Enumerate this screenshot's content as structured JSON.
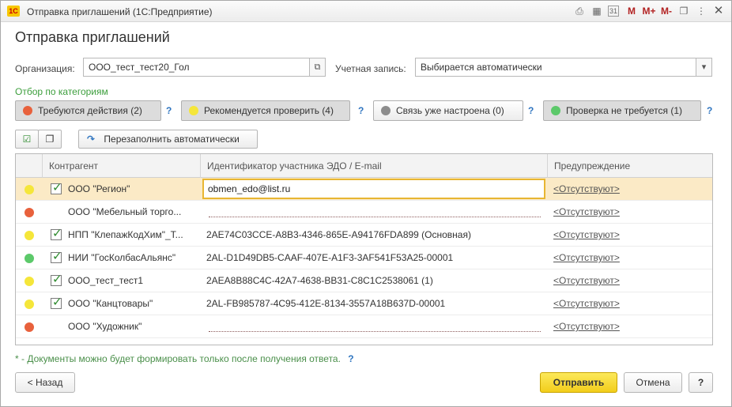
{
  "window": {
    "app_logo": "1С",
    "title": "Отправка приглашений  (1С:Предприятие)",
    "tb_m": "M",
    "tb_mplus": "M+",
    "tb_mminus": "M-",
    "tb_calendar_day": "31"
  },
  "form": {
    "title": "Отправка приглашений"
  },
  "organization": {
    "label": "Организация:",
    "value": "ООО_тест_тест20_Гол"
  },
  "account": {
    "label": "Учетная запись:",
    "value": "Выбирается автоматически"
  },
  "filter": {
    "caption": "Отбор по категориям",
    "buttons": [
      {
        "label": "Требуются действия (2)",
        "color": "#e8613c",
        "pressed": true
      },
      {
        "label": "Рекомендуется проверить (4)",
        "color": "#f5e63a",
        "pressed": true
      },
      {
        "label": "Связь уже настроена (0)",
        "color": "#8c8c8c",
        "pressed": false
      },
      {
        "label": "Проверка не требуется (1)",
        "color": "#5cc96a",
        "pressed": true
      }
    ],
    "help": "?"
  },
  "toolbar": {
    "refill_label": "Перезаполнить автоматически"
  },
  "table": {
    "headers": {
      "counterparty": "Контрагент",
      "identifier": "Идентификатор участника ЭДО / E-mail",
      "warning": "Предупреждение"
    },
    "rows": [
      {
        "color": "#f5e63a",
        "checked": true,
        "name": "ООО \"Регион\"",
        "identifier": "obmen_edo@list.ru",
        "warning": "<Отсутствуют>"
      },
      {
        "color": "#e8613c",
        "checked": false,
        "name": "ООО \"Мебельный торго...",
        "identifier": "",
        "warning": "<Отсутствуют>"
      },
      {
        "color": "#f5e63a",
        "checked": true,
        "name": "НПП \"КлепажКодХим\"_Т...",
        "identifier": "2AE74C03CCE-A8B3-4346-865E-A94176FDA899 (Основная)",
        "warning": "<Отсутствуют>"
      },
      {
        "color": "#5cc96a",
        "checked": true,
        "name": "НИИ \"ГосКолбасАльянс\"",
        "identifier": "2AL-D1D49DB5-CAAF-407E-A1F3-3AF541F53A25-00001",
        "warning": "<Отсутствуют>"
      },
      {
        "color": "#f5e63a",
        "checked": true,
        "name": "ООО_тест_тест1",
        "identifier": "2AEA8B88C4C-42A7-4638-BB31-C8C1C2538061 (1)",
        "warning": "<Отсутствуют>"
      },
      {
        "color": "#f5e63a",
        "checked": true,
        "name": "ООО \"Канцтовары\"",
        "identifier": "2AL-FB985787-4C95-412E-8134-3557A18B637D-00001",
        "warning": "<Отсутствуют>"
      },
      {
        "color": "#e8613c",
        "checked": false,
        "name": "ООО \"Художник\"",
        "identifier": "",
        "warning": "<Отсутствуют>"
      }
    ]
  },
  "footnote": "* - Документы можно будет формировать только после получения ответа.",
  "buttons": {
    "back": "< Назад",
    "send": "Отправить",
    "cancel": "Отмена",
    "help": "?"
  }
}
